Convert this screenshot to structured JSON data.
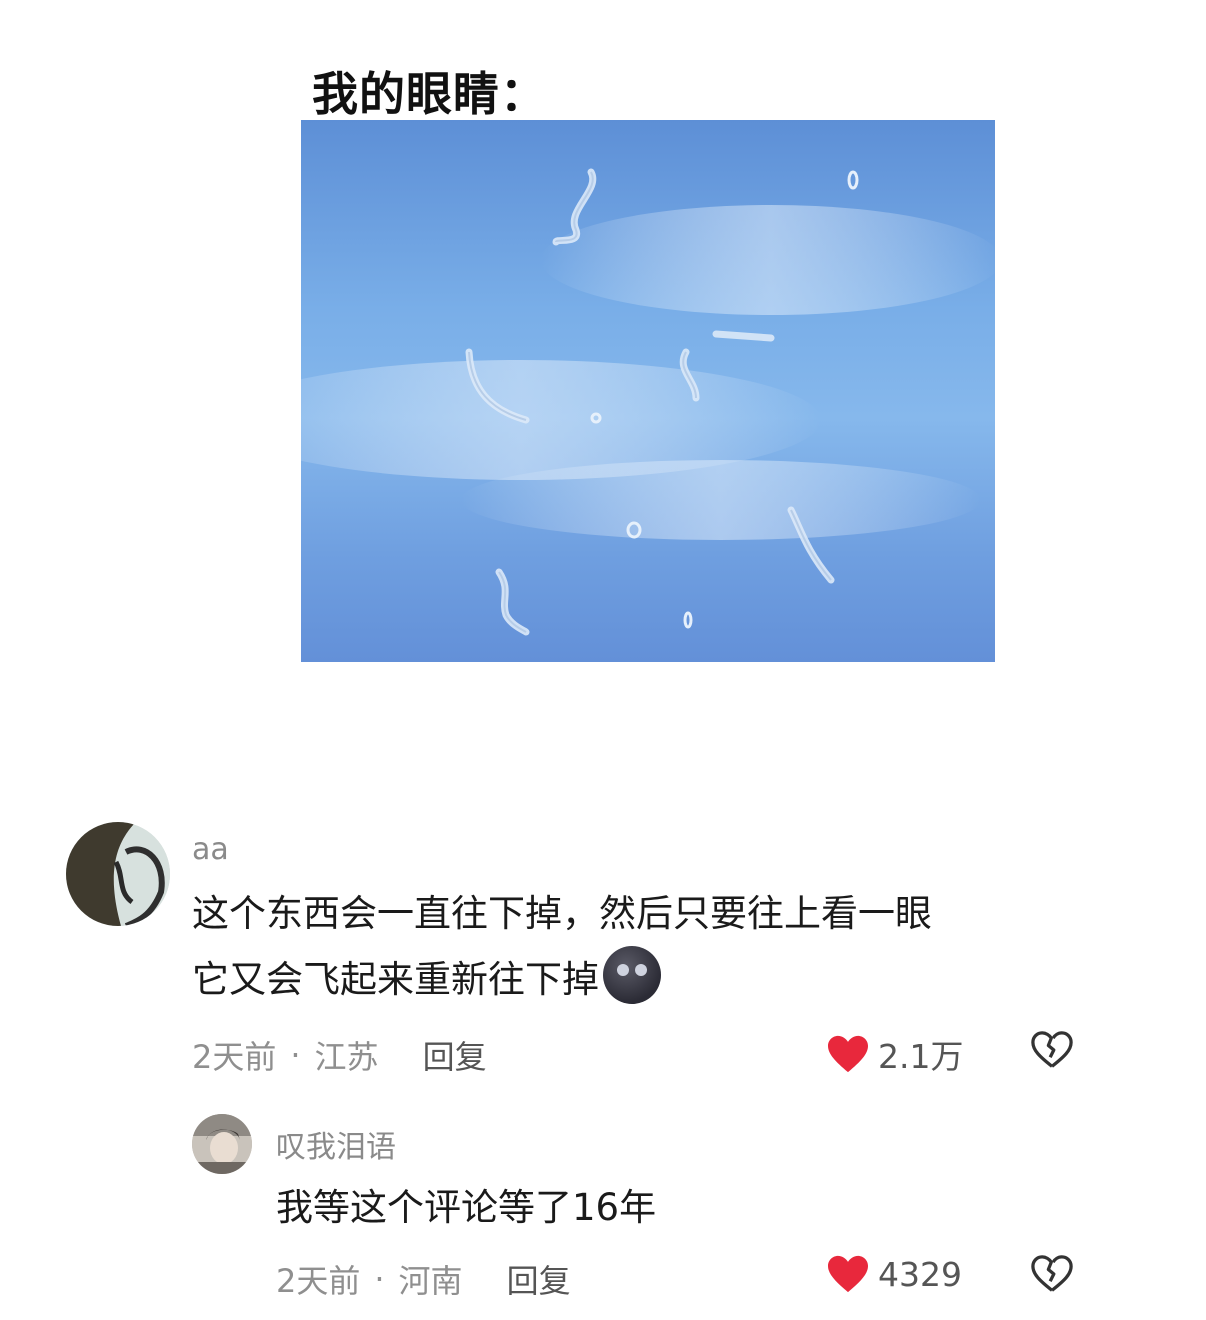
{
  "post": {
    "title": "我的眼睛："
  },
  "comments": [
    {
      "username": "aa",
      "text_line1": "这个东西会一直往下掉，然后只要往上看一眼",
      "text_line2": "它又会飞起来重新往下掉",
      "time": "2天前",
      "location": "江苏",
      "reply_label": "回复",
      "likes": "2.1万"
    },
    {
      "username": "叹我泪语",
      "text": "我等这个评论等了16年",
      "time": "2天前",
      "location": "河南",
      "reply_label": "回复",
      "likes": "4329"
    }
  ],
  "colors": {
    "heart": "#e8283c",
    "sky": "#79aee8"
  }
}
